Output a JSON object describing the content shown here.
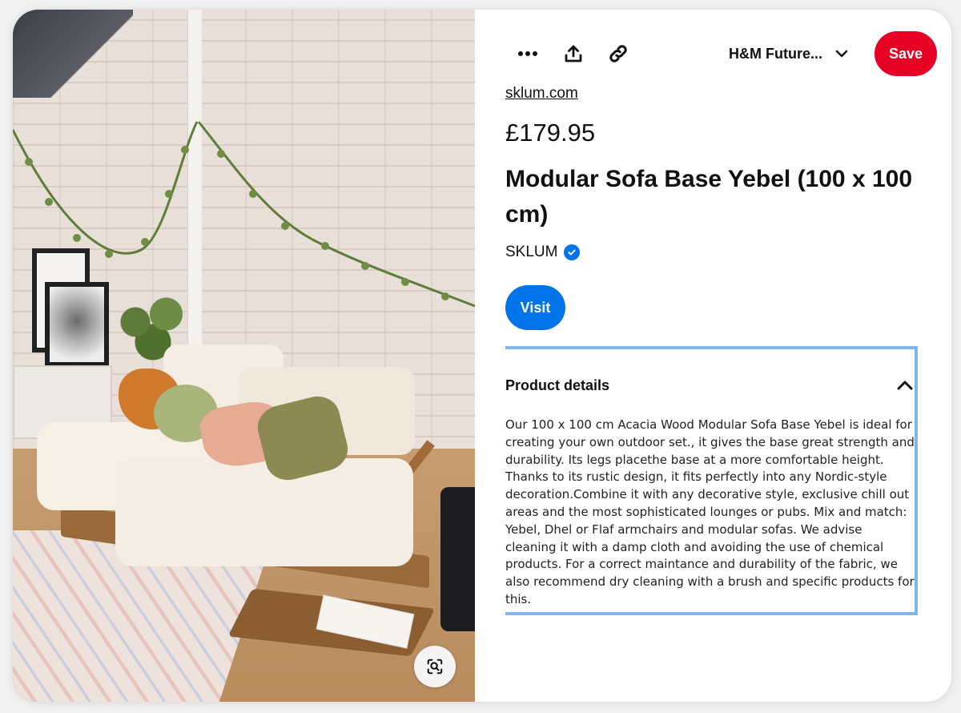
{
  "toolbar": {
    "more_icon": "more-horizontal-icon",
    "share_icon": "share-upload-icon",
    "link_icon": "link-icon",
    "board_name": "H&M Future...",
    "save_label": "Save"
  },
  "product": {
    "source": "sklum.com",
    "price": "£179.95",
    "title": "Modular Sofa Base Yebel (100 x 100 cm)",
    "brand": "SKLUM",
    "brand_verified": true,
    "visit_label": "Visit"
  },
  "details": {
    "heading": "Product details",
    "expanded": true,
    "description": "Our 100 x 100 cm Acacia Wood Modular Sofa Base Yebel  is ideal for creating your own outdoor set., it gives the base great strength and durability. Its legs placethe base at a more comfortable height. Thanks to its rustic design, it fits perfectly into any Nordic-style decoration.Combine it with any decorative style, exclusive chill out areas and the most sophisticated lounges or pubs. Mix and match: Yebel, Dhel or Flaf armchairs and modular sofas. We advise cleaning it with a damp cloth and avoiding the use of chemical products. For a correct maintance and durability of the fabric, we also recommend dry cleaning with a brush and specific products for this."
  },
  "image": {
    "lens_icon": "visual-search-icon"
  },
  "colors": {
    "save_red": "#e60023",
    "visit_blue": "#0074e8",
    "focus_outline": "#7fb6f2"
  }
}
